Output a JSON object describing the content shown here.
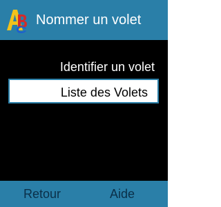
{
  "title_bar": {
    "icon": "abc-app-icon",
    "title": "Nommer un volet"
  },
  "menu": {
    "items": [
      {
        "label": "Identifier un volet",
        "selected": false
      },
      {
        "label": "Liste des Volets",
        "selected": true
      }
    ]
  },
  "softkeys": {
    "left_label": "Retour",
    "right_label": "Aide"
  },
  "colors": {
    "accent": "#2a7fa8",
    "background": "#000000",
    "softkey_text": "#0a2f48"
  }
}
